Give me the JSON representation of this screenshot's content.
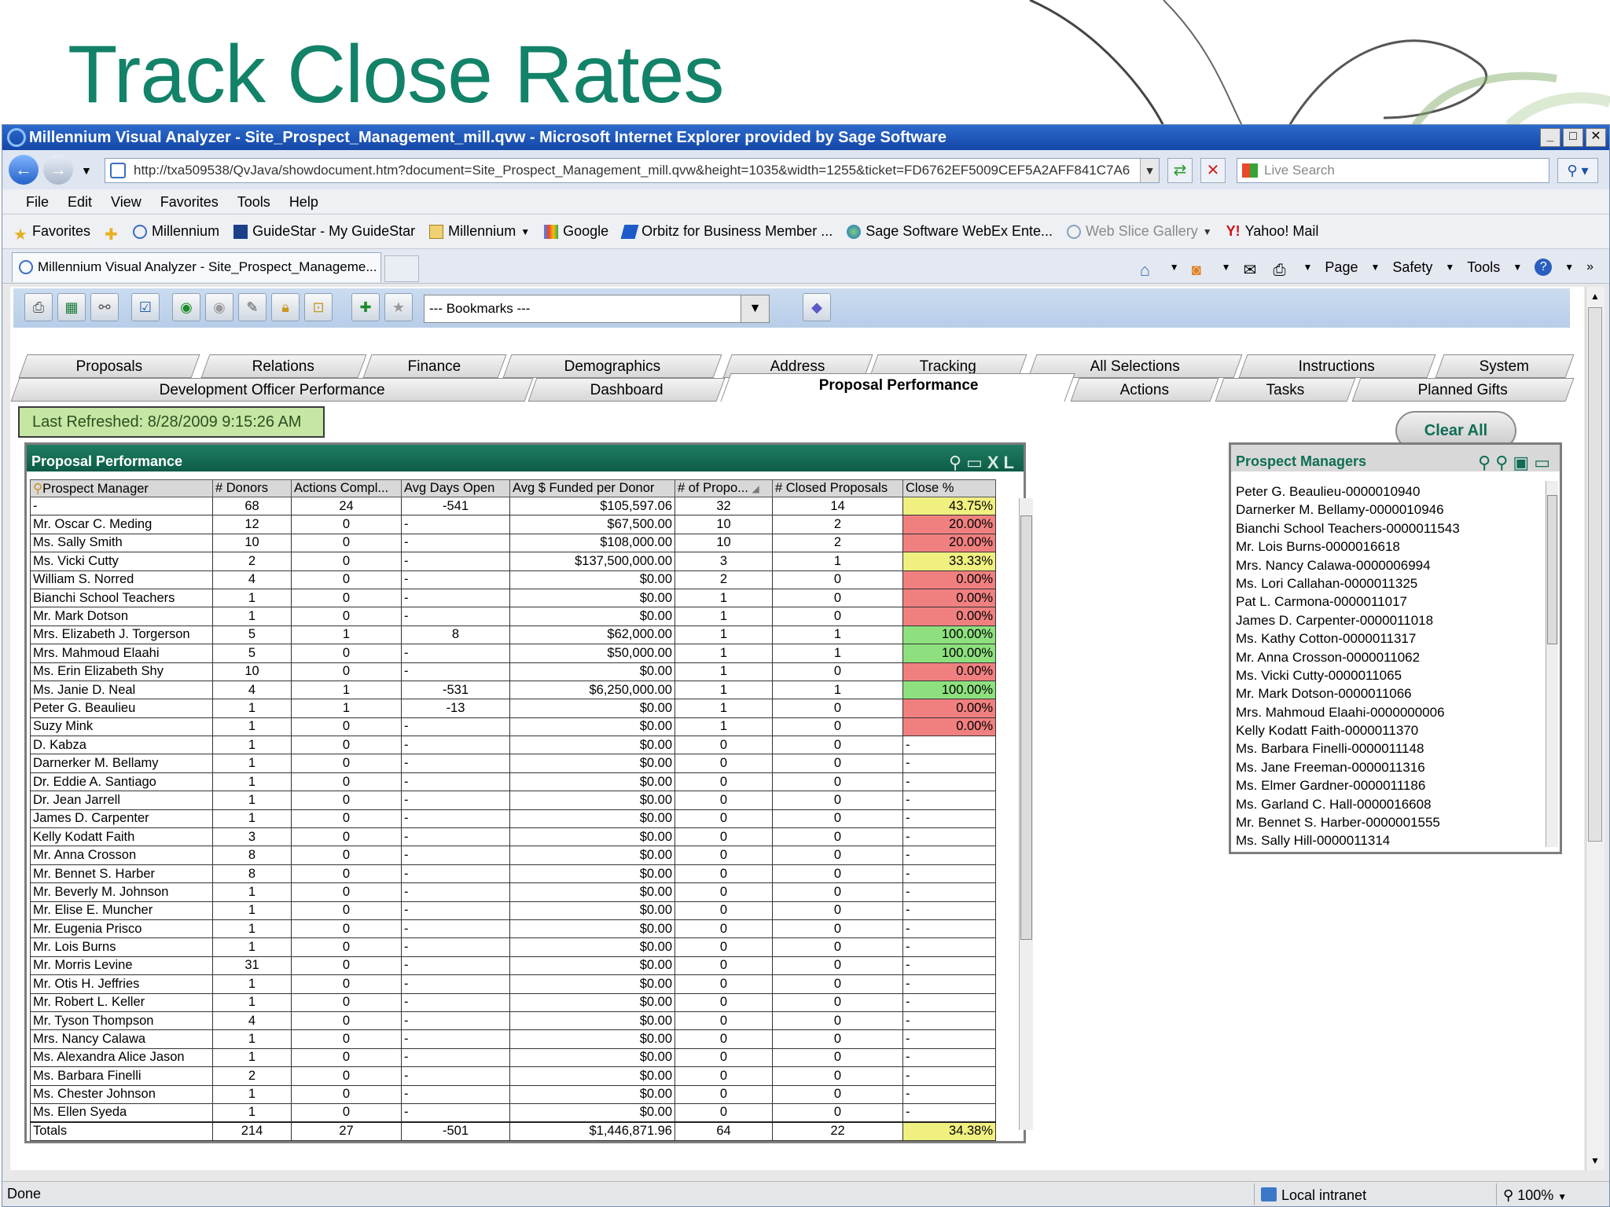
{
  "slide": {
    "title": "Track Close Rates"
  },
  "browser": {
    "window_title": "Millennium Visual Analyzer - Site_Prospect_Management_mill.qvw - Microsoft Internet Explorer provided by Sage Software",
    "address": "http://txa509538/QvJava/showdocument.htm?document=Site_Prospect_Management_mill.qvw&height=1035&width=1255&ticket=FD6762EF5009CEF5A2AFF841C7A6",
    "search_placeholder": "Live Search",
    "menu": [
      "File",
      "Edit",
      "View",
      "Favorites",
      "Tools",
      "Help"
    ],
    "favorites_label": "Favorites",
    "favorites": [
      "Millennium",
      "GuideStar - My GuideStar",
      "Millennium",
      "Google",
      "Orbitz for Business Member ...",
      "Sage Software WebEx Ente...",
      "Web Slice Gallery",
      "Yahoo! Mail"
    ],
    "tab_title": "Millennium Visual Analyzer - Site_Prospect_Manageme...",
    "command_bar": [
      "Page",
      "Safety",
      "Tools"
    ],
    "status": {
      "left": "Done",
      "zone": "Local intranet",
      "zoom": "100%"
    }
  },
  "app": {
    "bookmarks_placeholder": "--- Bookmarks ---",
    "tabs_row1": [
      "Proposals",
      "Relations",
      "Finance",
      "Demographics",
      "Address",
      "Tracking",
      "All Selections",
      "Instructions",
      "System"
    ],
    "tabs_row2": [
      "Development Officer Performance",
      "Dashboard",
      "Proposal Performance",
      "Actions",
      "Tasks",
      "Planned Gifts"
    ],
    "last_refreshed": "Last Refreshed: 8/28/2009 9:15:26 AM",
    "clear_all": "Clear All",
    "proposal_panel": {
      "title": "Proposal Performance",
      "columns": [
        "Prospect Manager",
        "# Donors",
        "Actions Compl...",
        "Avg Days Open",
        "Avg $ Funded per Donor",
        "# of Propo...",
        "# Closed Proposals",
        "Close %"
      ],
      "rows": [
        [
          "-",
          "68",
          "24",
          "-541",
          "$105,597.06",
          "32",
          "14",
          "43.75%"
        ],
        [
          "Mr. Oscar C. Meding",
          "12",
          "0",
          "-",
          "$67,500.00",
          "10",
          "2",
          "20.00%"
        ],
        [
          "Ms. Sally Smith",
          "10",
          "0",
          "-",
          "$108,000.00",
          "10",
          "2",
          "20.00%"
        ],
        [
          "Ms. Vicki Cutty",
          "2",
          "0",
          "-",
          "$137,500,000.00",
          "3",
          "1",
          "33.33%"
        ],
        [
          "William S. Norred",
          "4",
          "0",
          "-",
          "$0.00",
          "2",
          "0",
          "0.00%"
        ],
        [
          "Bianchi School Teachers",
          "1",
          "0",
          "-",
          "$0.00",
          "1",
          "0",
          "0.00%"
        ],
        [
          "Mr. Mark Dotson",
          "1",
          "0",
          "-",
          "$0.00",
          "1",
          "0",
          "0.00%"
        ],
        [
          "Mrs. Elizabeth J. Torgerson",
          "5",
          "1",
          "8",
          "$62,000.00",
          "1",
          "1",
          "100.00%"
        ],
        [
          "Mrs. Mahmoud Elaahi",
          "5",
          "0",
          "-",
          "$50,000.00",
          "1",
          "1",
          "100.00%"
        ],
        [
          "Ms. Erin Elizabeth Shy",
          "10",
          "0",
          "-",
          "$0.00",
          "1",
          "0",
          "0.00%"
        ],
        [
          "Ms. Janie D. Neal",
          "4",
          "1",
          "-531",
          "$6,250,000.00",
          "1",
          "1",
          "100.00%"
        ],
        [
          "Peter G. Beaulieu",
          "1",
          "1",
          "-13",
          "$0.00",
          "1",
          "0",
          "0.00%"
        ],
        [
          "Suzy Mink",
          "1",
          "0",
          "-",
          "$0.00",
          "1",
          "0",
          "0.00%"
        ],
        [
          "D. Kabza",
          "1",
          "0",
          "-",
          "$0.00",
          "0",
          "0",
          "-"
        ],
        [
          "Darnerker M. Bellamy",
          "1",
          "0",
          "-",
          "$0.00",
          "0",
          "0",
          "-"
        ],
        [
          "Dr. Eddie A. Santiago",
          "1",
          "0",
          "-",
          "$0.00",
          "0",
          "0",
          "-"
        ],
        [
          "Dr. Jean Jarrell",
          "1",
          "0",
          "-",
          "$0.00",
          "0",
          "0",
          "-"
        ],
        [
          "James D. Carpenter",
          "1",
          "0",
          "-",
          "$0.00",
          "0",
          "0",
          "-"
        ],
        [
          "Kelly Kodatt Faith",
          "3",
          "0",
          "-",
          "$0.00",
          "0",
          "0",
          "-"
        ],
        [
          "Mr. Anna Crosson",
          "8",
          "0",
          "-",
          "$0.00",
          "0",
          "0",
          "-"
        ],
        [
          "Mr. Bennet S. Harber",
          "8",
          "0",
          "-",
          "$0.00",
          "0",
          "0",
          "-"
        ],
        [
          "Mr. Beverly M. Johnson",
          "1",
          "0",
          "-",
          "$0.00",
          "0",
          "0",
          "-"
        ],
        [
          "Mr. Elise E. Muncher",
          "1",
          "0",
          "-",
          "$0.00",
          "0",
          "0",
          "-"
        ],
        [
          "Mr. Eugenia Prisco",
          "1",
          "0",
          "-",
          "$0.00",
          "0",
          "0",
          "-"
        ],
        [
          "Mr. Lois Burns",
          "1",
          "0",
          "-",
          "$0.00",
          "0",
          "0",
          "-"
        ],
        [
          "Mr. Morris Levine",
          "31",
          "0",
          "-",
          "$0.00",
          "0",
          "0",
          "-"
        ],
        [
          "Mr. Otis H. Jeffries",
          "1",
          "0",
          "-",
          "$0.00",
          "0",
          "0",
          "-"
        ],
        [
          "Mr. Robert L. Keller",
          "1",
          "0",
          "-",
          "$0.00",
          "0",
          "0",
          "-"
        ],
        [
          "Mr. Tyson Thompson",
          "4",
          "0",
          "-",
          "$0.00",
          "0",
          "0",
          "-"
        ],
        [
          "Mrs. Nancy Calawa",
          "1",
          "0",
          "-",
          "$0.00",
          "0",
          "0",
          "-"
        ],
        [
          "Ms. Alexandra Alice Jason",
          "1",
          "0",
          "-",
          "$0.00",
          "0",
          "0",
          "-"
        ],
        [
          "Ms. Barbara Finelli",
          "2",
          "0",
          "-",
          "$0.00",
          "0",
          "0",
          "-"
        ],
        [
          "Ms. Chester Johnson",
          "1",
          "0",
          "-",
          "$0.00",
          "0",
          "0",
          "-"
        ],
        [
          "Ms. Ellen Syeda",
          "1",
          "0",
          "-",
          "$0.00",
          "0",
          "0",
          "-"
        ]
      ],
      "row_colors": [
        "y",
        "rd",
        "rd",
        "y",
        "rd",
        "rd",
        "rd",
        "g",
        "g",
        "rd",
        "g",
        "rd",
        "rd",
        "",
        "",
        "",
        "",
        "",
        "",
        "",
        "",
        "",
        "",
        "",
        "",
        "",
        "",
        "",
        "",
        "",
        "",
        "",
        "",
        ""
      ],
      "totals": [
        "Totals",
        "214",
        "27",
        "-501",
        "$1,446,871.96",
        "64",
        "22",
        "34.38%"
      ]
    },
    "prospect_panel": {
      "title": "Prospect Managers",
      "items": [
        "Peter G. Beaulieu-0000010940",
        "Darnerker M. Bellamy-0000010946",
        "Bianchi School Teachers-0000011543",
        "Mr. Lois Burns-0000016618",
        "Mrs. Nancy Calawa-0000006994",
        "Ms. Lori Callahan-0000011325",
        "Pat L. Carmona-0000011017",
        "James D. Carpenter-0000011018",
        "Ms. Kathy Cotton-0000011317",
        "Mr. Anna Crosson-0000011062",
        "Ms. Vicki Cutty-0000011065",
        "Mr. Mark Dotson-0000011066",
        "Mrs. Mahmoud Elaahi-0000000006",
        "Kelly Kodatt Faith-0000011370",
        "Ms. Barbara Finelli-0000011148",
        "Ms. Jane Freeman-0000011316",
        "Ms. Elmer Gardner-0000011186",
        "Ms. Garland C. Hall-0000016608",
        "Mr. Bennet S. Harber-0000001555",
        "Ms. Sally Hill-0000011314"
      ]
    }
  }
}
